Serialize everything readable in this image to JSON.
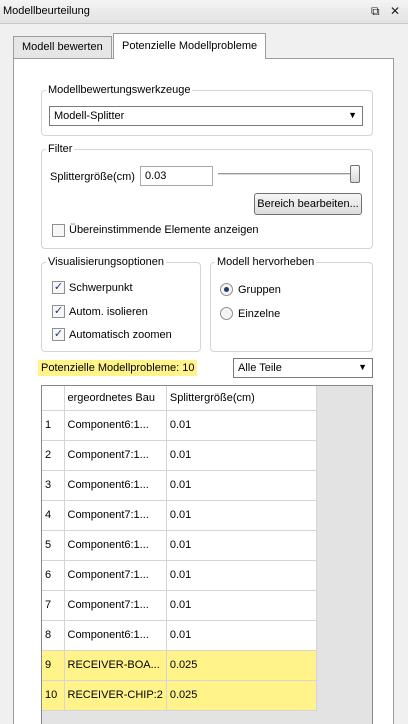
{
  "window": {
    "title": "Modellbeurteilung"
  },
  "tabs": [
    {
      "label": "Modell bewerten"
    },
    {
      "label": "Potenzielle Modellprobleme"
    }
  ],
  "tools": {
    "legend": "Modellbewertungswerkzeuge",
    "selected": "Modell-Splitter"
  },
  "filter": {
    "legend": "Filter",
    "size_label": "Splittergröße(cm)",
    "size_value": "0.03",
    "slider_level": 1.0,
    "edit_range_label": "Bereich bearbeiten...",
    "show_matching_label": "Übereinstimmende Elemente anzeigen",
    "show_matching_checked": false
  },
  "visualization": {
    "legend": "Visualisierungsoptionen",
    "options": [
      {
        "label": "Schwerpunkt",
        "checked": true
      },
      {
        "label": "Autom. isolieren",
        "checked": true
      },
      {
        "label": "Automatisch zoomen",
        "checked": true
      }
    ]
  },
  "highlight": {
    "legend": "Modell hervorheben",
    "options": [
      {
        "label": "Gruppen",
        "selected": true
      },
      {
        "label": "Einzelne",
        "selected": false
      }
    ]
  },
  "problems": {
    "count_label": "Potenzielle Modellprobleme: 10",
    "filter_selected": "Alle Teile"
  },
  "table": {
    "columns": [
      "ergeordnetes Bau",
      "Splittergröße(cm)"
    ],
    "rows": [
      {
        "n": "1",
        "part": "Component6:1...",
        "size": "0.01",
        "highlighted": false
      },
      {
        "n": "2",
        "part": "Component7:1...",
        "size": "0.01",
        "highlighted": false
      },
      {
        "n": "3",
        "part": "Component6:1...",
        "size": "0.01",
        "highlighted": false
      },
      {
        "n": "4",
        "part": "Component7:1...",
        "size": "0.01",
        "highlighted": false
      },
      {
        "n": "5",
        "part": "Component6:1...",
        "size": "0.01",
        "highlighted": false
      },
      {
        "n": "6",
        "part": "Component7:1...",
        "size": "0.01",
        "highlighted": false
      },
      {
        "n": "7",
        "part": "Component7:1...",
        "size": "0.01",
        "highlighted": false
      },
      {
        "n": "8",
        "part": "Component6:1...",
        "size": "0.01",
        "highlighted": false
      },
      {
        "n": "9",
        "part": "RECEIVER-BOA...",
        "size": "0.025",
        "highlighted": true
      },
      {
        "n": "10",
        "part": "RECEIVER-CHIP:2",
        "size": "0.025",
        "highlighted": true
      }
    ]
  },
  "colors": {
    "highlight": "#fff38a",
    "panel_background": "#f0f0f0",
    "check_mark": "#1b3b7a"
  },
  "icons": {
    "pin": "pin-icon",
    "close": "close-icon",
    "dropdown": "chevron-down-icon",
    "check": "checkmark-icon"
  }
}
